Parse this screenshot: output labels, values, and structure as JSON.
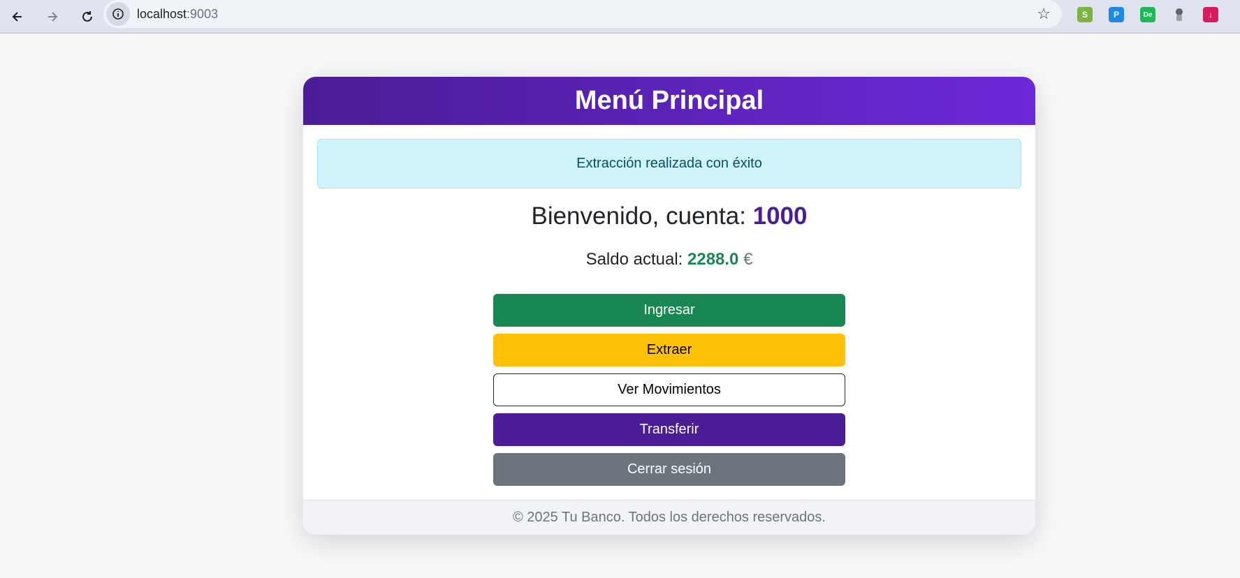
{
  "browser": {
    "url_host": "localhost",
    "url_port": ":9003",
    "icons": [
      "back-arrow-icon",
      "forward-arrow-icon",
      "reload-icon",
      "site-info-icon",
      "bookmark-star-icon"
    ],
    "extensions": [
      {
        "name": "ext-s-icon",
        "label": "S",
        "color": "#7cb342"
      },
      {
        "name": "ext-p-icon",
        "label": "P",
        "color": "#1e88e5"
      },
      {
        "name": "ext-de-icon",
        "label": "De",
        "color": "#1db954"
      },
      {
        "name": "ext-robot-icon",
        "label": "",
        "color": "#9e9e9e"
      },
      {
        "name": "ext-download-icon",
        "label": "↓",
        "color": "#d81b60"
      }
    ]
  },
  "card": {
    "title": "Menú Principal",
    "alert": "Extracción realizada con éxito",
    "welcome_prefix": "Bienvenido, cuenta: ",
    "account_number": "1000",
    "balance_prefix": "Saldo actual: ",
    "balance_amount": "2288.0",
    "currency": "€",
    "buttons": {
      "deposit": "Ingresar",
      "withdraw": "Extraer",
      "movements": "Ver Movimientos",
      "transfer": "Transferir",
      "logout": "Cerrar sesión"
    },
    "footer": "© 2025 Tu Banco. Todos los derechos reservados."
  },
  "colors": {
    "header_gradient_start": "#4a1d96",
    "header_gradient_end": "#6d28d9",
    "success": "#198754",
    "warning": "#ffc107",
    "purple": "#4a1d96",
    "secondary": "#6c757d",
    "info_bg": "#cff4fc"
  }
}
